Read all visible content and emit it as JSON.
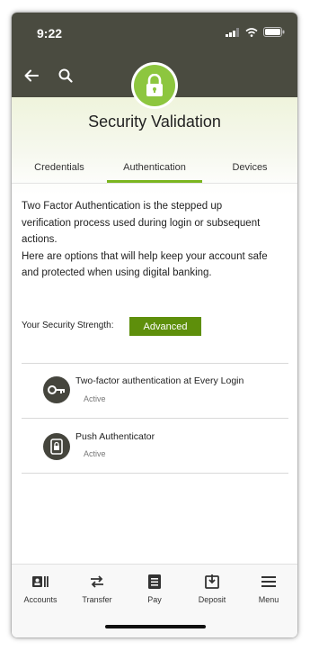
{
  "status_bar": {
    "time": "9:22"
  },
  "header": {
    "title": "Security Validation"
  },
  "tabs": [
    {
      "label": "Credentials",
      "active": false
    },
    {
      "label": "Authentication",
      "active": true
    },
    {
      "label": "Devices",
      "active": false
    }
  ],
  "description": {
    "line1": "Two Factor Authentication is the stepped up",
    "line2": "verification process used during login or subsequent",
    "line3": "actions.",
    "line4": "Here are options that will help keep your account safe",
    "line5": "and protected when using digital banking."
  },
  "security_strength": {
    "label": "Your Security Strength:",
    "value": "Advanced"
  },
  "methods": [
    {
      "title": "Two-factor authentication at Every Login",
      "status": "Active",
      "icon": "key-icon"
    },
    {
      "title": "Push Authenticator",
      "status": "Active",
      "icon": "phone-lock-icon"
    }
  ],
  "bottom_nav": [
    {
      "label": "Accounts",
      "icon": "accounts-icon"
    },
    {
      "label": "Transfer",
      "icon": "transfer-icon"
    },
    {
      "label": "Pay",
      "icon": "pay-icon"
    },
    {
      "label": "Deposit",
      "icon": "deposit-icon"
    },
    {
      "label": "Menu",
      "icon": "menu-icon"
    }
  ],
  "colors": {
    "header_bg": "#4a4b40",
    "accent_green": "#8dc63f",
    "badge_green": "#5e8f0b",
    "tab_underline": "#7ab51d"
  }
}
